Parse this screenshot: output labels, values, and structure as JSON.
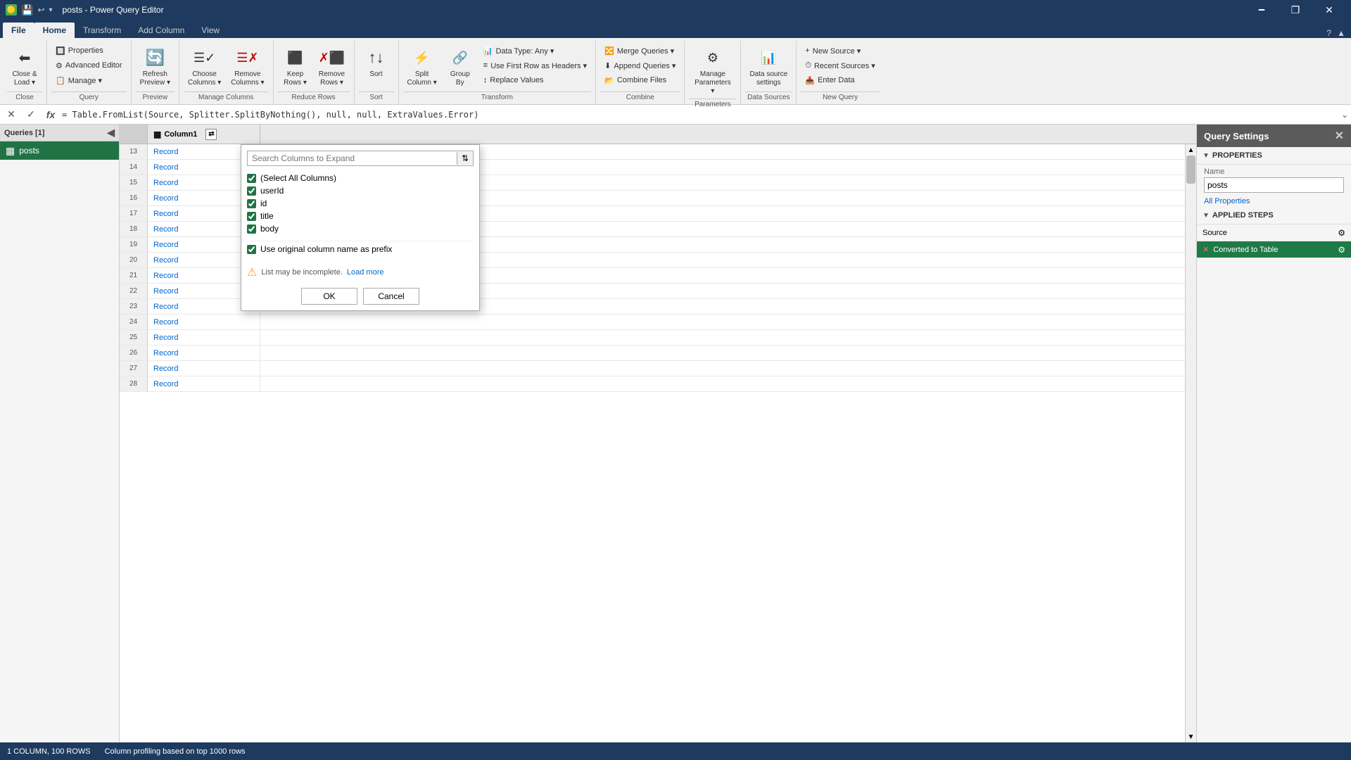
{
  "titleBar": {
    "icon": "🟡",
    "title": "posts - Power Query Editor",
    "minimize": "🗕",
    "maximize": "🗗",
    "close": "✕",
    "restore": "❐"
  },
  "ribbonTabs": {
    "tabs": [
      "File",
      "Home",
      "Transform",
      "Add Column",
      "View"
    ]
  },
  "ribbonGroups": [
    {
      "name": "close",
      "label": "Close",
      "items": [
        {
          "icon": "⬅",
          "label": "Close &\nLoad ▾"
        }
      ]
    },
    {
      "name": "query",
      "label": "Query",
      "items_small": [
        {
          "icon": "🔲",
          "label": "Properties"
        },
        {
          "icon": "⚙",
          "label": "Advanced Editor"
        },
        {
          "icon": "📋",
          "label": "Manage ▾"
        }
      ]
    },
    {
      "name": "preview",
      "label": "Preview",
      "items": [
        {
          "icon": "🔄",
          "label": "Refresh\nPreview ▾"
        }
      ]
    },
    {
      "name": "manage-columns",
      "label": "Manage Columns",
      "items": [
        {
          "icon": "☰✓",
          "label": "Choose\nColumns ▾"
        },
        {
          "icon": "☰✗",
          "label": "Remove\nColumns ▾"
        }
      ]
    },
    {
      "name": "reduce-rows",
      "label": "Reduce Rows",
      "items": [
        {
          "icon": "⬛",
          "label": "Keep\nRows ▾"
        },
        {
          "icon": "✗⬛",
          "label": "Remove\nRows ▾"
        }
      ]
    },
    {
      "name": "sort",
      "label": "Sort",
      "items": [
        {
          "icon": "↑↓",
          "label": "Sort"
        }
      ]
    },
    {
      "name": "transform",
      "label": "Transform",
      "items": [
        {
          "icon": "⚡",
          "label": "Split\nColumn ▾"
        },
        {
          "icon": "🔗",
          "label": "Group\nBy"
        }
      ],
      "items_small": [
        {
          "label": "Data Type: Any ▾"
        },
        {
          "label": "Use First Row as Headers ▾"
        },
        {
          "label": "↕ Replace Values"
        }
      ]
    },
    {
      "name": "combine",
      "label": "Combine",
      "items_small": [
        {
          "label": "Merge Queries ▾"
        },
        {
          "label": "Append Queries ▾"
        },
        {
          "label": "Combine Files"
        }
      ]
    },
    {
      "name": "parameters",
      "label": "Parameters",
      "items": [
        {
          "icon": "⚙",
          "label": "Manage\nParameters ▾"
        }
      ]
    },
    {
      "name": "data-sources",
      "label": "Data Sources",
      "items": [
        {
          "icon": "📊",
          "label": "Data source\nsettings"
        }
      ]
    },
    {
      "name": "new-query",
      "label": "New Query",
      "items": [
        {
          "icon": "+",
          "label": "New Source ▾"
        },
        {
          "icon": "⏱",
          "label": "Recent Sources ▾"
        },
        {
          "icon": "📥",
          "label": "Enter Data"
        }
      ]
    }
  ],
  "formulaBar": {
    "cancelBtn": "✕",
    "confirmBtn": "✓",
    "fxBtn": "fx",
    "formula": "= Table.FromList(Source, Splitter.SplitByNothing(), null, null, ExtraValues.Error)",
    "expandBtn": "⌄"
  },
  "queriesPanel": {
    "title": "Queries [1]",
    "collapseIcon": "◀",
    "items": [
      {
        "name": "posts",
        "icon": "▦",
        "active": true
      }
    ]
  },
  "gridHeader": {
    "rowNumLabel": "",
    "columns": [
      {
        "name": "Column1",
        "icon": "▦",
        "hasExpand": true
      }
    ]
  },
  "gridRows": [
    {
      "num": 13,
      "col1": "Record"
    },
    {
      "num": 14,
      "col1": "Record"
    },
    {
      "num": 15,
      "col1": "Record"
    },
    {
      "num": 16,
      "col1": "Record"
    },
    {
      "num": 17,
      "col1": "Record"
    },
    {
      "num": 18,
      "col1": "Record"
    },
    {
      "num": 19,
      "col1": "Record"
    },
    {
      "num": 20,
      "col1": "Record"
    },
    {
      "num": 21,
      "col1": "Record"
    },
    {
      "num": 22,
      "col1": "Record"
    },
    {
      "num": 23,
      "col1": "Record"
    },
    {
      "num": 24,
      "col1": "Record"
    },
    {
      "num": 25,
      "col1": "Record"
    },
    {
      "num": 26,
      "col1": "Record"
    },
    {
      "num": 27,
      "col1": "Record"
    },
    {
      "num": 28,
      "col1": "Record"
    }
  ],
  "expandDropdown": {
    "searchPlaceholder": "Search Columns to Expand",
    "searchIcon": "⇅",
    "columns": [
      {
        "label": "(Select All Columns)",
        "checked": true
      },
      {
        "label": "userId",
        "checked": true
      },
      {
        "label": "id",
        "checked": true
      },
      {
        "label": "title",
        "checked": true
      },
      {
        "label": "body",
        "checked": true
      }
    ],
    "prefixLabel": "Use original column name as prefix",
    "prefixChecked": true,
    "warningIcon": "⚠",
    "warningText": "List may be incomplete.",
    "loadMoreLabel": "Load more",
    "okLabel": "OK",
    "cancelLabel": "Cancel"
  },
  "rightPanel": {
    "title": "Query Settings",
    "closeIcon": "✕",
    "propertiesLabel": "PROPERTIES",
    "nameLabel": "Name",
    "nameValue": "posts",
    "allPropertiesLabel": "All Properties",
    "appliedStepsLabel": "APPLIED STEPS",
    "steps": [
      {
        "label": "Source",
        "active": false,
        "hasGear": true,
        "icon": ""
      },
      {
        "label": "Converted to Table",
        "active": true,
        "hasGear": true,
        "icon": "✕"
      }
    ]
  },
  "statusBar": {
    "cols": "1 COLUMN, 100 ROWS",
    "profiling": "Column profiling based on top 1000 rows"
  }
}
